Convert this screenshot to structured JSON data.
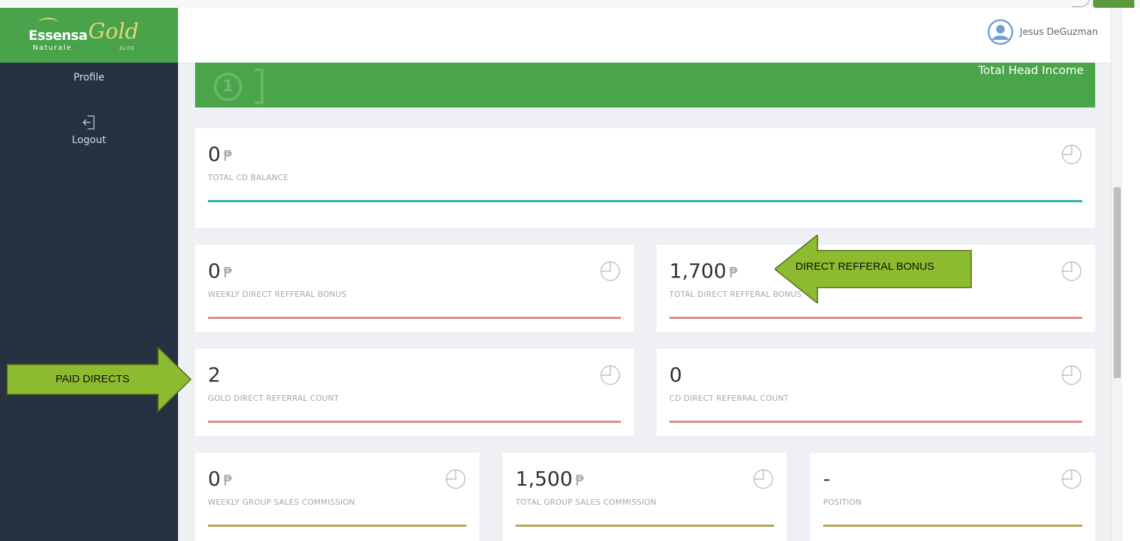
{
  "app": {
    "brand": "Essensa",
    "brand_sub": "Naturale",
    "brand_gold": "Gold",
    "brand_elite": "ELITE"
  },
  "sidebar": {
    "items": [
      {
        "label": "Profile",
        "icon": "profile-icon"
      },
      {
        "label": "Logout",
        "icon": "logout-icon"
      }
    ]
  },
  "header": {
    "user_name": "Jesus DeGuzman",
    "avatar_icon": "user-avatar-icon"
  },
  "banner": {
    "label": "Total Head Income"
  },
  "currency_symbol": "₱",
  "cards": {
    "total_cd_balance": {
      "value": "0",
      "label": "TOTAL CD BALANCE",
      "bar_color": "#26b3b0"
    },
    "weekly_direct_referral_bonus": {
      "value": "0",
      "label": "WEEKLY DIRECT REFFERAL BONUS",
      "bar_color": "#e08a8a"
    },
    "total_direct_referral_bonus": {
      "value": "1,700",
      "label": "TOTAL DIRECT REFFERAL BONUS",
      "bar_color": "#e08a8a"
    },
    "gold_direct_referral_count": {
      "value": "2",
      "label": "GOLD DIRECT REFERRAL COUNT",
      "bar_color": "#e08a8a"
    },
    "cd_direct_referral_count": {
      "value": "0",
      "label": "CD DIRECT REFERRAL COUNT",
      "bar_color": "#e08a8a"
    },
    "weekly_group_sales_commission": {
      "value": "0",
      "label": "WEEKLY GROUP SALES COMMISSION",
      "bar_color": "#b5a252"
    },
    "total_group_sales_commission": {
      "value": "1,500",
      "label": "TOTAL GROUP SALES COMMISSION",
      "bar_color": "#b5a252"
    },
    "position": {
      "value": "-",
      "label": "POSITION",
      "bar_color": "#b5a252"
    }
  },
  "annotations": {
    "direct_referral_bonus": "DIRECT REFFERAL BONUS",
    "paid_directs": "PAID DIRECTS",
    "arrow_color": "#8dbb2f"
  }
}
